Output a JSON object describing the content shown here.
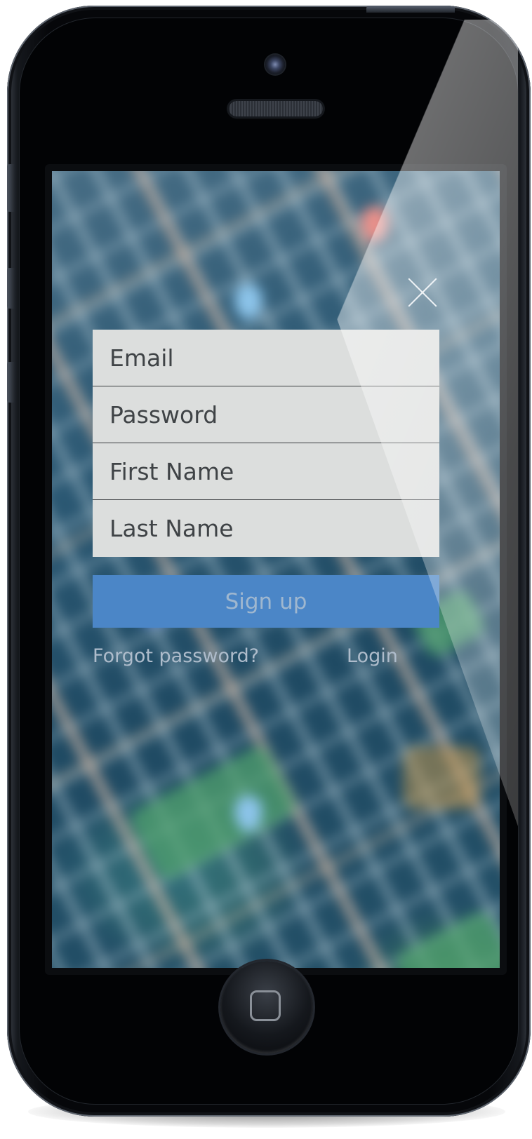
{
  "device": {
    "type": "iphone-mockup"
  },
  "signup_form": {
    "fields": [
      {
        "name": "email",
        "placeholder": "Email",
        "value": ""
      },
      {
        "name": "password",
        "placeholder": "Password",
        "value": ""
      },
      {
        "name": "first_name",
        "placeholder": "First Name",
        "value": ""
      },
      {
        "name": "last_name",
        "placeholder": "Last Name",
        "value": ""
      }
    ],
    "submit_label": "Sign up",
    "forgot_password_label": "Forgot password?",
    "login_label": "Login"
  },
  "icons": {
    "close": "close-icon",
    "home": "home-button-icon"
  },
  "colors": {
    "field_background": "#dcdedd",
    "button_background": "#4b86c7",
    "button_text": "#9fb7cf",
    "link_text": "#aebccb",
    "map_background": "#214a61"
  }
}
